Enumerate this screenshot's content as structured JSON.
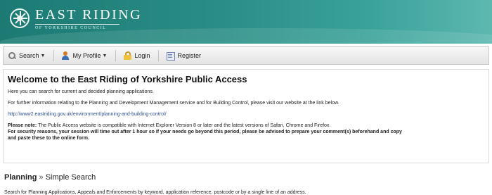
{
  "header": {
    "council_name": "EAST RIDING",
    "council_sub": "OF YORKSHIRE COUNCIL"
  },
  "toolbar": {
    "search_label": "Search",
    "profile_label": "My Profile",
    "login_label": "Login",
    "register_label": "Register"
  },
  "welcome": {
    "title": "Welcome to the East Riding of Yorkshire Public Access",
    "intro": "Here you can search for current and decided planning applications.",
    "further_info": "For further information relating to the Planning and Development Management service and for Building Control, please visit our website at the link below.",
    "link": "http://www2.eastriding.gov.uk/environment/planning-and-building-control/",
    "note_label": "Please note:",
    "note_text": " The Public Access website is compatible with Internet Explorer Version 8 or later and the latest versions of Safari, Chrome and Firefox.",
    "security_line1": "For security reasons, your session will time out after 1 hour so if your needs go beyond this period, please be advised to prepare your comment(s) beforehand and copy",
    "security_line2": "and paste these to the online form."
  },
  "planning": {
    "section": "Planning",
    "separator": "»",
    "page": "Simple Search",
    "description": "Search for Planning Applications, Appeals and Enforcements by keyword, application reference, postcode or by a single line of an address."
  },
  "icons": {
    "crest": "council-crest-icon",
    "search": "magnifier-icon",
    "profile": "person-icon",
    "login": "padlock-icon",
    "register": "form-icon"
  },
  "colors": {
    "banner": "#2a8e86",
    "link": "#2a4f8f"
  }
}
